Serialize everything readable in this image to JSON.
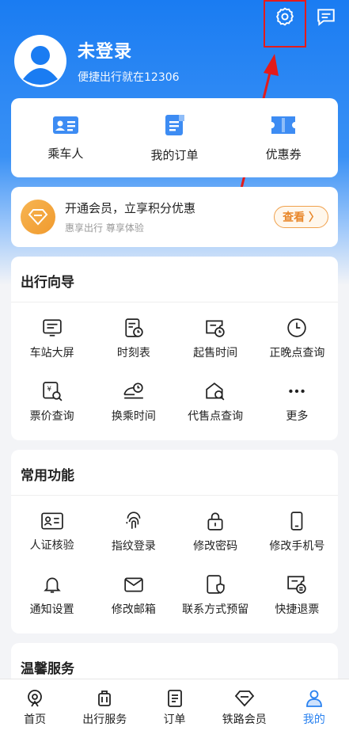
{
  "header": {
    "user_name": "未登录",
    "user_sub": "便捷出行就在12306"
  },
  "quick_actions": [
    {
      "label": "乘车人",
      "icon": "id-card-icon"
    },
    {
      "label": "我的订单",
      "icon": "order-doc-icon"
    },
    {
      "label": "优惠券",
      "icon": "coupon-icon"
    }
  ],
  "vip": {
    "title": "开通会员，立享积分优惠",
    "subtitle": "惠享出行 尊享体验",
    "button": "查看 〉"
  },
  "guide": {
    "title": "出行向导",
    "items": [
      {
        "label": "车站大屏",
        "icon": "station-screen-icon"
      },
      {
        "label": "时刻表",
        "icon": "timetable-icon"
      },
      {
        "label": "起售时间",
        "icon": "sale-time-icon"
      },
      {
        "label": "正晚点查询",
        "icon": "clock-icon"
      },
      {
        "label": "票价查询",
        "icon": "fare-query-icon"
      },
      {
        "label": "换乘时间",
        "icon": "transfer-time-icon"
      },
      {
        "label": "代售点查询",
        "icon": "agency-search-icon"
      },
      {
        "label": "更多",
        "icon": "more-icon"
      }
    ]
  },
  "common": {
    "title": "常用功能",
    "items": [
      {
        "label": "人证核验",
        "icon": "identity-check-icon"
      },
      {
        "label": "指纹登录",
        "icon": "fingerprint-icon"
      },
      {
        "label": "修改密码",
        "icon": "lock-icon"
      },
      {
        "label": "修改手机号",
        "icon": "phone-icon"
      },
      {
        "label": "通知设置",
        "icon": "bell-icon"
      },
      {
        "label": "修改邮箱",
        "icon": "mail-icon"
      },
      {
        "label": "联系方式预留",
        "icon": "contact-shield-icon"
      },
      {
        "label": "快捷退票",
        "icon": "refund-ticket-icon"
      }
    ]
  },
  "warm": {
    "title": "温馨服务"
  },
  "tabs": [
    {
      "label": "首页",
      "icon": "home-train-icon",
      "active": false
    },
    {
      "label": "出行服务",
      "icon": "luggage-icon",
      "active": false
    },
    {
      "label": "订单",
      "icon": "order-icon",
      "active": false
    },
    {
      "label": "铁路会员",
      "icon": "diamond-icon",
      "active": false
    },
    {
      "label": "我的",
      "icon": "person-icon",
      "active": true
    }
  ],
  "colors": {
    "brand_blue": "#1a7cf2",
    "icon_blue": "#3d8cf3",
    "vip_orange": "#f09a2e",
    "annotation_red": "#e31b1b"
  }
}
